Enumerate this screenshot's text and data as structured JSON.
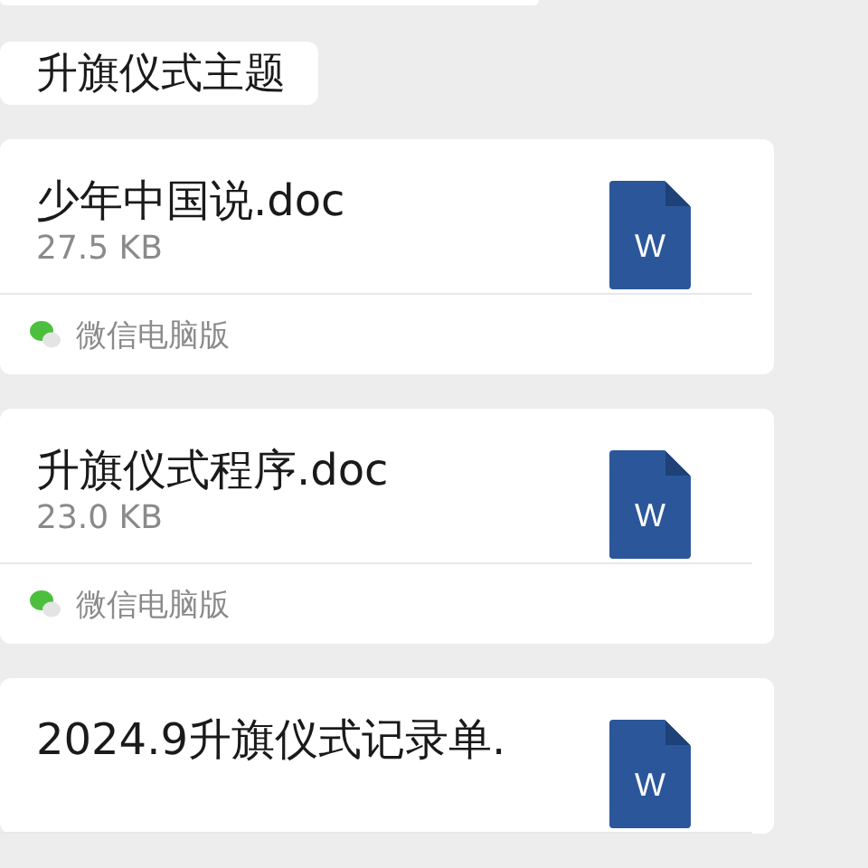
{
  "messages": [
    {
      "kind": "clipped"
    },
    {
      "kind": "text",
      "text": "升旗仪式主题"
    },
    {
      "kind": "file",
      "name": "少年中国说.doc",
      "size": "27.5 KB",
      "icon_letter": "W",
      "source": "微信电脑版"
    },
    {
      "kind": "file",
      "name": "升旗仪式程序.doc",
      "size": "23.0 KB",
      "icon_letter": "W",
      "source": "微信电脑版"
    },
    {
      "kind": "file",
      "name": "2024.9升旗仪式记录单.",
      "icon_letter": "W"
    }
  ]
}
